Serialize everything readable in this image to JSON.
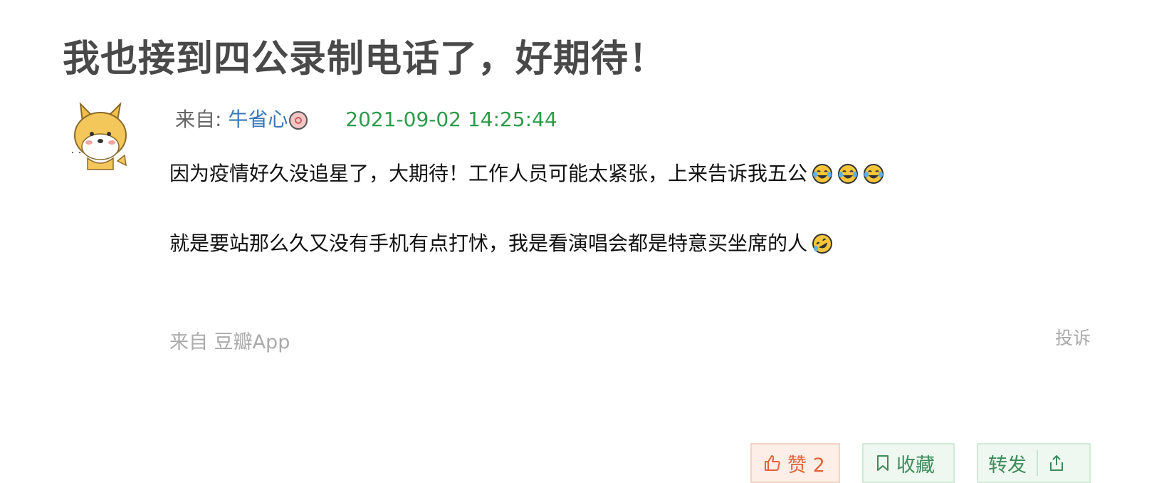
{
  "post": {
    "title": "我也接到四公录制电话了，好期待！",
    "from_label": "来自: ",
    "author": "牛省心",
    "timestamp": "2021-09-02 14:25:44",
    "paragraphs": [
      "因为疫情好久没追星了，大期待！工作人员可能太紧张，上来告诉我五公",
      "就是要站那么久又没有手机有点打怵，我是看演唱会都是特意买坐席的人"
    ],
    "emojis": [
      "laughing-tears-emoji",
      "laughing-tears-emoji",
      "laughing-tears-emoji",
      "rolling-laughing-emoji"
    ],
    "source": "来自 豆瓣App",
    "report": "投诉"
  },
  "actions": {
    "like_label": "赞 2",
    "collect_label": "收藏",
    "share_label": "转发"
  },
  "colors": {
    "author": "#3a77b8",
    "timestamp": "#2d9b4a",
    "like": "#e2623b",
    "collect": "#3d8b5a"
  }
}
